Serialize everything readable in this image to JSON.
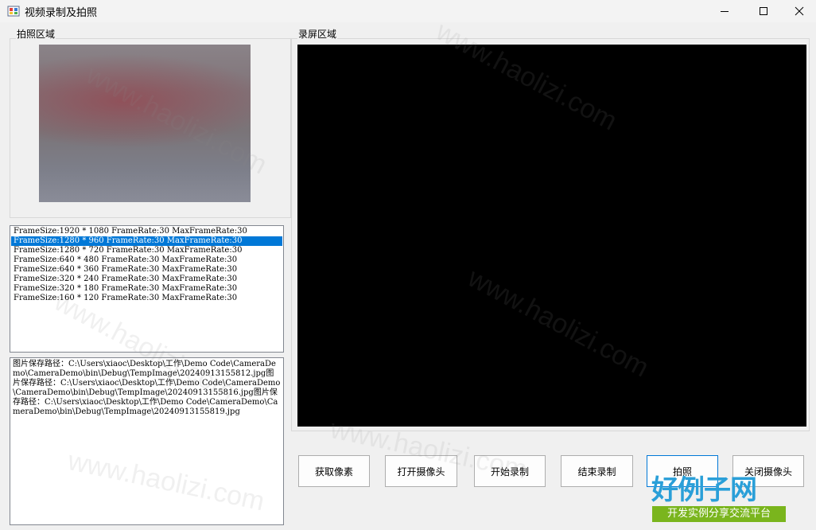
{
  "window": {
    "title": "视频录制及拍照",
    "minimize_glyph": "—",
    "maximize_glyph": "☐",
    "close_glyph": "✕"
  },
  "photo_group": {
    "label": "拍照区域"
  },
  "record_group": {
    "label": "录屏区域"
  },
  "resolution_list": {
    "items": [
      "FrameSize:1920 * 1080 FrameRate:30 MaxFrameRate:30",
      "FrameSize:1280 * 960 FrameRate:30 MaxFrameRate:30",
      "FrameSize:1280 * 720 FrameRate:30 MaxFrameRate:30",
      "FrameSize:640 * 480 FrameRate:30 MaxFrameRate:30",
      "FrameSize:640 * 360 FrameRate:30 MaxFrameRate:30",
      "FrameSize:320 * 240 FrameRate:30 MaxFrameRate:30",
      "FrameSize:320 * 180 FrameRate:30 MaxFrameRate:30",
      "FrameSize:160 * 120 FrameRate:30 MaxFrameRate:30"
    ],
    "selected_index": 1
  },
  "log": {
    "text": "图片保存路径：C:\\Users\\xiaoc\\Desktop\\工作\\Demo Code\\CameraDemo\\CameraDemo\\bin\\Debug\\TempImage\\20240913155812.jpg图片保存路径：C:\\Users\\xiaoc\\Desktop\\工作\\Demo Code\\CameraDemo\\CameraDemo\\bin\\Debug\\TempImage\\20240913155816.jpg图片保存路径：C:\\Users\\xiaoc\\Desktop\\工作\\Demo Code\\CameraDemo\\CameraDemo\\bin\\Debug\\TempImage\\20240913155819.jpg"
  },
  "buttons": {
    "get_pixels": "获取像素",
    "open_camera": "打开摄像头",
    "start_record": "开始录制",
    "stop_record": "结束录制",
    "take_photo": "拍照",
    "close_camera": "关闭摄像头"
  },
  "watermark": {
    "text": "www.haolizi.com",
    "logo": "好例子网",
    "logo_sub": "开发实例分享交流平台"
  },
  "colors": {
    "selection": "#0078d7",
    "logo_blue": "#2a9fd8",
    "logo_green": "#7ab51d"
  }
}
